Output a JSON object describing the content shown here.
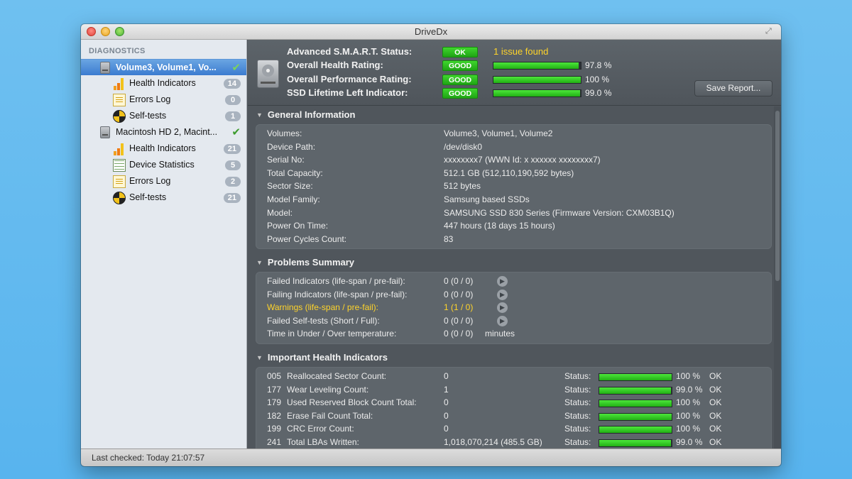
{
  "window": {
    "title": "DriveDx"
  },
  "sidebar": {
    "header": "DIAGNOSTICS",
    "drives": [
      {
        "label": "Volume3, Volume1, Vo...",
        "selected": true,
        "items": [
          {
            "label": "Health Indicators",
            "badge": "14",
            "icon": "bar-chart-icon"
          },
          {
            "label": "Errors Log",
            "badge": "0",
            "icon": "log-icon"
          },
          {
            "label": "Self-tests",
            "badge": "1",
            "icon": "self-test-icon"
          }
        ]
      },
      {
        "label": "Macintosh HD 2, Macint...",
        "selected": false,
        "items": [
          {
            "label": "Health Indicators",
            "badge": "21",
            "icon": "bar-chart-icon"
          },
          {
            "label": "Device Statistics",
            "badge": "5",
            "icon": "stats-table-icon"
          },
          {
            "label": "Errors Log",
            "badge": "2",
            "icon": "log-icon"
          },
          {
            "label": "Self-tests",
            "badge": "21",
            "icon": "self-test-icon"
          }
        ]
      }
    ]
  },
  "summary": {
    "smart_label": "Advanced S.M.A.R.T. Status:",
    "smart_status": "OK",
    "smart_issue": "1 issue found",
    "health_label": "Overall Health Rating:",
    "health_status": "GOOD",
    "health_value": "97.8 %",
    "health_fraction": 0.978,
    "perf_label": "Overall Performance Rating:",
    "perf_status": "GOOD",
    "perf_value": "100 %",
    "perf_fraction": 1.0,
    "ssd_label": "SSD Lifetime Left Indicator:",
    "ssd_status": "GOOD",
    "ssd_value": "99.0 %",
    "ssd_fraction": 0.99,
    "save_button": "Save Report..."
  },
  "general": {
    "title": "General Information",
    "rows": [
      {
        "label": "Volumes:",
        "value": "Volume3, Volume1, Volume2"
      },
      {
        "label": "Device Path:",
        "value": "/dev/disk0"
      },
      {
        "label": "Serial No:",
        "value": "xxxxxxxx7 (WWN Id: x xxxxxx xxxxxxxx7)"
      },
      {
        "label": "Total Capacity:",
        "value": "512.1 GB (512,110,190,592 bytes)"
      },
      {
        "label": "Sector Size:",
        "value": "512 bytes"
      },
      {
        "label": "Model Family:",
        "value": "Samsung based SSDs"
      },
      {
        "label": "Model:",
        "value": "SAMSUNG SSD 830 Series  (Firmware Version: CXM03B1Q)"
      },
      {
        "label": "Power On Time:",
        "value": "447 hours (18 days 15 hours)"
      },
      {
        "label": "Power Cycles Count:",
        "value": "83"
      }
    ]
  },
  "problems": {
    "title": "Problems Summary",
    "rows": [
      {
        "label": "Failed Indicators (life-span / pre-fail):",
        "value": "0 (0 / 0)",
        "warn": false
      },
      {
        "label": "Failing Indicators (life-span / pre-fail):",
        "value": "0 (0 / 0)",
        "warn": false
      },
      {
        "label": "Warnings (life-span / pre-fail):",
        "value": "1 (1 / 0)",
        "warn": true
      },
      {
        "label": "Failed Self-tests (Short / Full):",
        "value": "0 (0 / 0)",
        "warn": false
      },
      {
        "label": "Time in Under / Over temperature:",
        "value": "0 (0 / 0)",
        "unit": "minutes",
        "warn": false
      }
    ]
  },
  "health": {
    "title": "Important Health Indicators",
    "status_label": "Status:",
    "rows": [
      {
        "id": "005",
        "name": "Reallocated Sector Count:",
        "value": "0",
        "pct": "100 %",
        "fraction": 1.0,
        "ok": "OK"
      },
      {
        "id": "177",
        "name": "Wear Leveling Count:",
        "value": "1",
        "pct": "99.0 %",
        "fraction": 0.99,
        "ok": "OK"
      },
      {
        "id": "179",
        "name": "Used Reserved Block Count Total:",
        "value": "0",
        "pct": "100 %",
        "fraction": 1.0,
        "ok": "OK"
      },
      {
        "id": "182",
        "name": "Erase Fail Count Total:",
        "value": "0",
        "pct": "100 %",
        "fraction": 1.0,
        "ok": "OK"
      },
      {
        "id": "199",
        "name": "CRC Error Count:",
        "value": "0",
        "pct": "100 %",
        "fraction": 1.0,
        "ok": "OK"
      },
      {
        "id": "241",
        "name": "Total LBAs Written:",
        "value": "1,018,070,214 (485.5 GB)",
        "pct": "99.0 %",
        "fraction": 0.99,
        "ok": "OK"
      }
    ]
  },
  "statusbar": {
    "text": "Last checked: Today 21:07:57"
  },
  "colors": {
    "good_green": "#2fc21f",
    "warning_yellow": "#ffd42a",
    "selection_blue": "#3b7bd0"
  }
}
